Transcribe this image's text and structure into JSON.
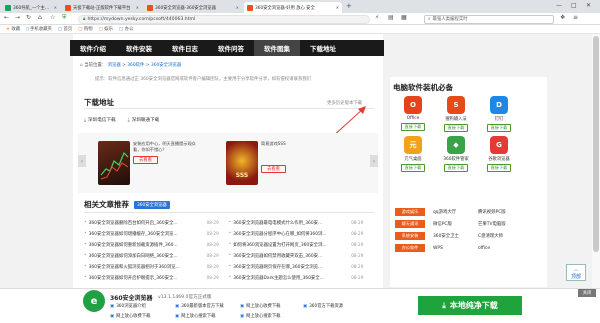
{
  "tabs": [
    {
      "label": "360导航_一个主页，整个世界",
      "color": "#19a15f",
      "active": false
    },
    {
      "label": "天极下载站-正版软件下载平台",
      "color": "#e8531c",
      "active": false
    },
    {
      "label": "360安全浏览器-360安全浏览器",
      "color": "#e8531c",
      "active": false
    },
    {
      "label": "360安全浏览器-好用 放心 安全",
      "color": "#e8531c",
      "active": true
    }
  ],
  "address": {
    "url": "https://mydown.yesky.com/pcsoft/440063.html",
    "search_placeholder": "最强人类编程实时"
  },
  "bookmarks": [
    "收藏",
    "手机收藏夹",
    "首页",
    "购物",
    "娱乐",
    "办公"
  ],
  "nav": {
    "items": [
      "软件介绍",
      "软件安装",
      "软件日志",
      "软件问答",
      "软件图集",
      "下载地址"
    ],
    "active": 4
  },
  "breadcrumb": {
    "prefix": "当前位置：",
    "items": [
      "浏览器",
      "360软件",
      "360安全浏览器"
    ]
  },
  "note": "提示：软件信息通过正 360安全浏览器官网或软件客户编辑团队，主要用于分享软件分享，如有侵权请联系我们",
  "download": {
    "title": "下载地址",
    "more": "更多历史版本下载",
    "links": [
      "深圳电信下载",
      "深圳联通下载"
    ]
  },
  "carousel": [
    {
      "desc": "安装应用中心，明天直播提示观众看，你如不错心？",
      "button": "去看看"
    },
    {
      "desc": "简易游戏SSS",
      "button": "去看看"
    }
  ],
  "related": {
    "title": "相关文章推荐",
    "tag": "360安全浏览器",
    "rows": [
      {
        "left": "360安全浏览器删除百台如何开启_360安全...",
        "ld": "08-29",
        "right": "360安全浏览器最电电模式什么作用_360安...",
        "rd": "08-29"
      },
      {
        "left": "360安全浏览器如何增播缓存_360安全浏览...",
        "ld": "08-29",
        "right": "360安全浏览器分程序中心在哪_如何将360浏...",
        "rd": "08-29"
      },
      {
        "left": "360安全浏览器如何重新加载资源插件_360...",
        "ld": "08-29",
        "right": "如何将360浏览器设置为打开网页_360安全浏...",
        "rd": "08-29"
      },
      {
        "left": "360安全浏览器如何添加白日网络_360安全...",
        "ld": "08-29",
        "right": "360安全浏览器如何禁用收藏夹双击_360安...",
        "rd": "08-29"
      },
      {
        "left": "360安全浏览器和火狐浏览器相对于360浏览...",
        "ld": "08-29",
        "right": "360安全浏览器网页保存在哪_360安全浏览...",
        "rd": "08-29"
      },
      {
        "left": "360安全浏览器如何开启护眼提示_360安全...",
        "ld": "08-29",
        "right": "360安全浏览器Dark主题怎么使用_360安全...",
        "rd": "08-29"
      }
    ]
  },
  "side": {
    "title": "电脑软件装机必备",
    "apps": [
      {
        "name": "Office",
        "color": "#e8421c",
        "glyph": "O"
      },
      {
        "name": "搜狗输入法",
        "color": "#e64a19",
        "glyph": "S"
      },
      {
        "name": "钉钉",
        "color": "#1f88e5",
        "glyph": "D"
      },
      {
        "name": "元气桌面",
        "color": "#f0a21a",
        "glyph": "元"
      },
      {
        "name": "360软件管家",
        "color": "#3aa34a",
        "glyph": "◆"
      },
      {
        "name": "谷歌浏览器",
        "color": "#e53935",
        "glyph": "G"
      }
    ],
    "app_button": "直接下载",
    "cats": [
      {
        "cat": "游戏娱乐",
        "a": "qq游戏大厅",
        "b": "腾讯视频PC版"
      },
      {
        "cat": "聊天通讯",
        "a": "微信PC版",
        "b": "芒果TV电脑版"
      },
      {
        "cat": "系统安装",
        "a": "360安全卫士",
        "b": "C盘清理大师"
      },
      {
        "cat": "办公软件",
        "a": "WPS",
        "b": "office"
      }
    ]
  },
  "backtop": "顶部",
  "banner": {
    "app": "360安全浏览器",
    "version": "v13.1.1469.0官方正式版",
    "links": [
      "360浏览器介绍",
      "360最新版本官方下载",
      "网上放心收费下载",
      "360官方下载资源",
      "网上放心收费下载",
      "网上放心搜索下载",
      "网上放心搜索下载"
    ],
    "button": "本地纯净下载",
    "close": "关闭"
  }
}
